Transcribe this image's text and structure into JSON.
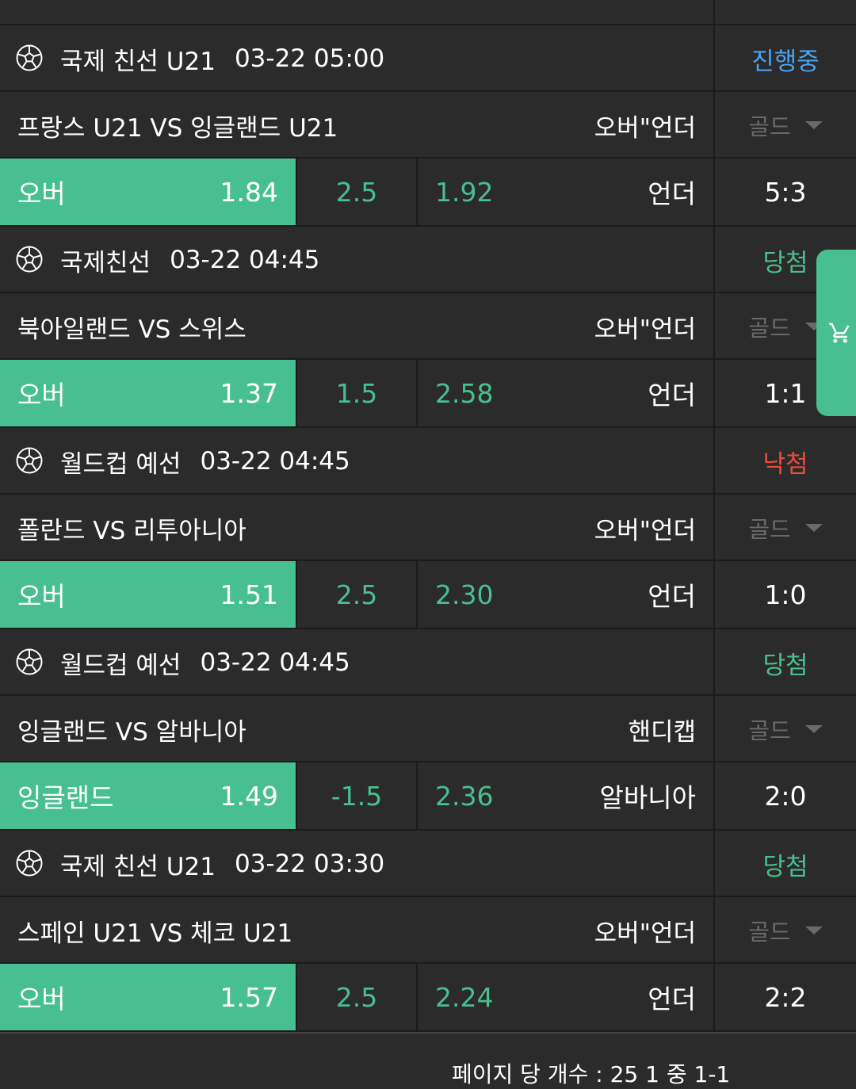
{
  "colors": {
    "accent_green": "#48bf91",
    "status_live": "#4aa3f0",
    "status_win": "#48bf91",
    "status_lose": "#e74c3c",
    "muted": "#6a6a6a"
  },
  "blocks": [
    {
      "league": "국제 친선 U21",
      "time": "03-22 05:00",
      "status": "진행중",
      "status_type": "live",
      "match": "프랑스 U21 VS 잉글랜드 U21",
      "bet_type": "오버\"언더",
      "grade": "골드",
      "over_label": "오버",
      "over_odds": "1.84",
      "line": "2.5",
      "under_odds": "1.92",
      "under_label": "언더",
      "score": "5:3"
    },
    {
      "league": "국제친선",
      "time": "03-22 04:45",
      "status": "당첨",
      "status_type": "win",
      "match": "북아일랜드 VS 스위스",
      "bet_type": "오버\"언더",
      "grade": "골드",
      "over_label": "오버",
      "over_odds": "1.37",
      "line": "1.5",
      "under_odds": "2.58",
      "under_label": "언더",
      "score": "1:1"
    },
    {
      "league": "월드컵 예선",
      "time": "03-22 04:45",
      "status": "낙첨",
      "status_type": "lose",
      "match": "폴란드 VS 리투아니아",
      "bet_type": "오버\"언더",
      "grade": "골드",
      "over_label": "오버",
      "over_odds": "1.51",
      "line": "2.5",
      "under_odds": "2.30",
      "under_label": "언더",
      "score": "1:0"
    },
    {
      "league": "월드컵 예선",
      "time": "03-22 04:45",
      "status": "당첨",
      "status_type": "win",
      "match": "잉글랜드 VS 알바니아",
      "bet_type": "핸디캡",
      "grade": "골드",
      "over_label": "잉글랜드",
      "over_odds": "1.49",
      "line": "-1.5",
      "under_odds": "2.36",
      "under_label": "알바니아",
      "score": "2:0"
    },
    {
      "league": "국제 친선 U21",
      "time": "03-22 03:30",
      "status": "당첨",
      "status_type": "win",
      "match": "스페인 U21 VS 체코 U21",
      "bet_type": "오버\"언더",
      "grade": "골드",
      "over_label": "오버",
      "over_odds": "1.57",
      "line": "2.5",
      "under_odds": "2.24",
      "under_label": "언더",
      "score": "2:2"
    }
  ],
  "footer": {
    "pager_text": "페이지 당 개수 : 25    1 중 1-1"
  },
  "cart": {
    "icon": "shopping-cart-icon"
  }
}
